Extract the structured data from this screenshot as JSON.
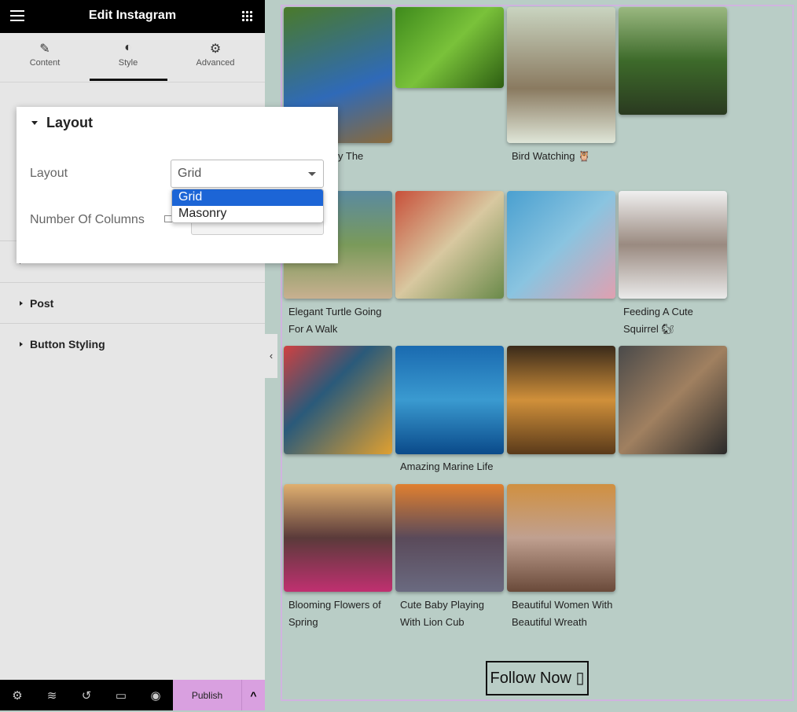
{
  "header": {
    "title": "Edit Instagram",
    "menu_icon": "hamburger-icon",
    "apps_icon": "grid-icon"
  },
  "tabs": [
    {
      "label": "Content",
      "icon": "pencil-icon"
    },
    {
      "label": "Style",
      "icon": "contrast-icon",
      "active": true
    },
    {
      "label": "Advanced",
      "icon": "gear-icon"
    }
  ],
  "layout_section": {
    "title": "Layout",
    "layout_label": "Layout",
    "layout_value": "Grid",
    "layout_options": [
      "Grid",
      "Masonry"
    ],
    "highlighted_option": "Grid",
    "columns_label": "Number Of Columns"
  },
  "sections": [
    "Post",
    "Button Styling"
  ],
  "footer": {
    "publish_label": "Publish",
    "icons": [
      "settings-icon",
      "layers-icon",
      "history-icon",
      "responsive-icon",
      "preview-icon"
    ]
  },
  "colors": {
    "accent": "#d9a0e0",
    "selected": "#1c65d6",
    "canvas": "#b9cdc6"
  },
  "gallery": {
    "captions": [
      "y The",
      "Bird Watching 🦉",
      "Elegant Turtle Going For A Walk",
      "Feeding A Cute Squirrel 🐿",
      "Amazing Marine Life",
      "Blooming Flowers of Spring",
      "Cute Baby Playing With Lion Cub",
      "Beautiful Women With Beautiful Wreath"
    ],
    "follow_label": "Follow Now ▯"
  }
}
